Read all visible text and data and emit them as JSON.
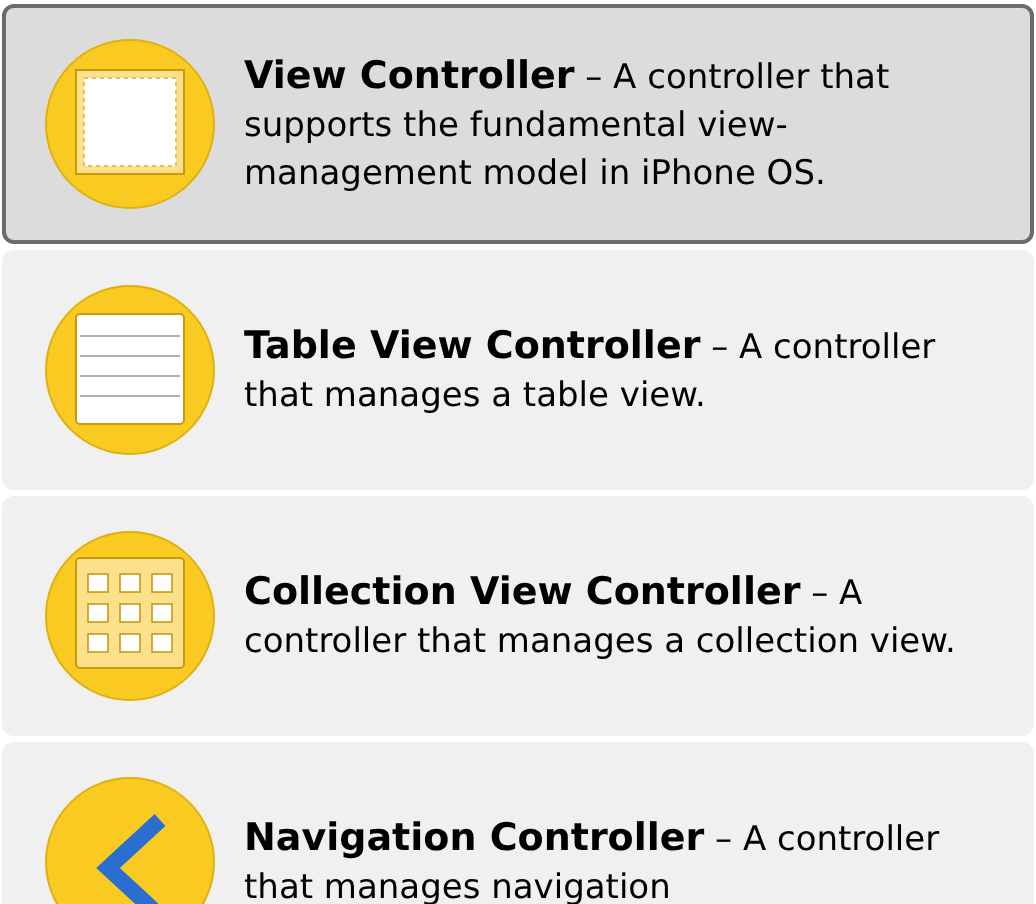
{
  "items": [
    {
      "kind": "view",
      "selected": true,
      "text": "**View Controller** – A controller that supports the fundamental view-management model in iPhone OS."
    },
    {
      "kind": "table",
      "selected": false,
      "text": "**Table View Controller** – A controller that manages a table view."
    },
    {
      "kind": "collection",
      "selected": false,
      "text": "**Collection View Controller** – A controller that manages a collection view."
    },
    {
      "kind": "navigation",
      "selected": false,
      "text": "**Navigation Controller** – A controller that manages navigation"
    }
  ]
}
